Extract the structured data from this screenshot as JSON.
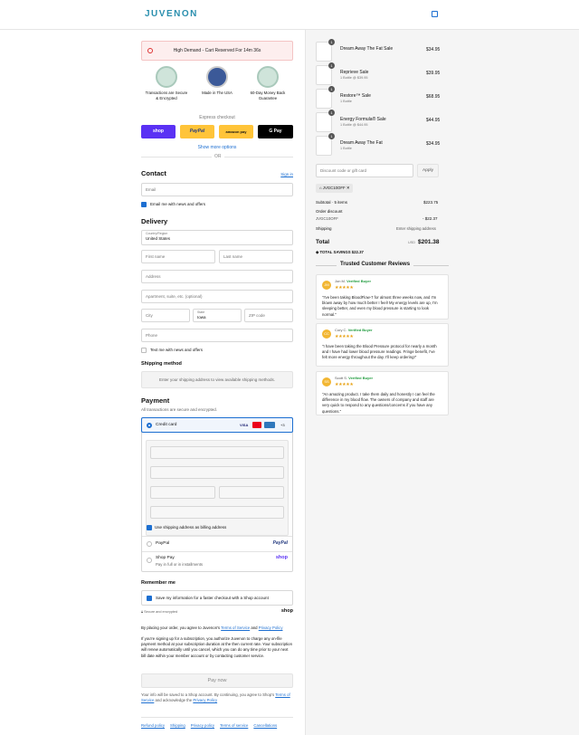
{
  "header": {
    "logo": "JUVENON"
  },
  "demand": "High Demand - Cart Reserved For 14m 36s",
  "badges": [
    {
      "label": "Transactions are Secure & Encrypted"
    },
    {
      "label": "Made in The USA"
    },
    {
      "label": "60-Day Money Back Guarantee"
    }
  ],
  "express": {
    "title": "Express checkout",
    "shop": "shop",
    "paypal": "PayPal",
    "amazon": "amazon pay",
    "gpay": "G Pay",
    "more": "Show more options",
    "or": "OR"
  },
  "contact": {
    "title": "Contact",
    "signin": "Sign in",
    "email_ph": "Email",
    "news": "Email me with news and offers"
  },
  "delivery": {
    "title": "Delivery",
    "country_label": "Country/Region",
    "country": "United States",
    "first": "First name",
    "last": "Last name",
    "address": "Address",
    "apt": "Apartment, suite, etc. (optional)",
    "city": "City",
    "state_label": "State",
    "state": "Iowa",
    "zip": "ZIP code",
    "phone": "Phone",
    "text": "Text me with news and offers"
  },
  "shipping": {
    "title": "Shipping method",
    "note": "Enter your shipping address to view available shipping methods."
  },
  "payment": {
    "title": "Payment",
    "sub": "All transactions are secure and encrypted.",
    "card": "Credit card",
    "more_cards": "+3",
    "billing": "Use shipping address as billing address",
    "paypal": "PayPal",
    "shoppay": "Shop Pay",
    "shoppay_sub": "Pay in full or in installments",
    "paypal_logo": "PayPal",
    "shop_logo": "shop"
  },
  "remember": {
    "title": "Remember me",
    "save": "Save my information for a faster checkout with a Shop account",
    "secure": "Secure and encrypted",
    "shop": "shop"
  },
  "legal": {
    "p1a": "By placing your order, you agree to Juvenon's ",
    "tos": "Terms of Service",
    "and": " and ",
    "privacy": "Privacy Policy",
    "p2": "If you're signing up for a subscription, you authorize Juvenon to charge any on-file payment method at your subscription duration at the then current rate. Your subscription will renew automatically until you cancel, which you can do any time prior to your next bill date within your member account or by contacting customer service.",
    "pay": "Pay now",
    "p3a": "Your info will be saved to a Shop account. By continuing, you agree to Shop's ",
    "p3tos": "Terms of Service",
    "p3b": " and acknowledge the ",
    "p3pp": "Privacy Policy"
  },
  "footer": [
    "Refund policy",
    "Shipping",
    "Privacy policy",
    "Terms of service",
    "Cancellations"
  ],
  "cart": {
    "items": [
      {
        "name": "Dream Away The Fat Sale",
        "sub": "",
        "price": "$34.95",
        "qty": "1"
      },
      {
        "name": "Reprieve Sale",
        "sub": "1 Bottle @ $39.95",
        "price": "$39.95",
        "qty": "1"
      },
      {
        "name": "Restore™ Sale",
        "sub": "1 Bottle",
        "price": "$68.95",
        "qty": "1"
      },
      {
        "name": "Energy Formula® Sale",
        "sub": "1 Bottle @ $44.95",
        "price": "$44.95",
        "qty": "1"
      },
      {
        "name": "Dream Away The Fat",
        "sub": "1 Bottle",
        "price": "$34.95",
        "qty": "1"
      }
    ],
    "discount_ph": "Discount code or gift card",
    "apply": "Apply",
    "code": "JVGC10OFF",
    "subtotal_label": "Subtotal · 5 items",
    "subtotal": "$223.75",
    "order_discount": "Order discount",
    "disc_code": "JVGC10OFF",
    "disc_val": "- $22.37",
    "shipping_label": "Shipping",
    "shipping_val": "Enter shipping address",
    "total_label": "Total",
    "currency": "USD",
    "total": "$201.38",
    "savings": "TOTAL SAVINGS $22.37"
  },
  "reviews": {
    "title": "Trusted Customer Reviews",
    "items": [
      {
        "init": "JM",
        "name": "Jon M.",
        "verified": "Verified Buyer",
        "text": "\"I've been taking BloodFlow-7 for almost three weeks now, and I'm blown away by how much better I feel! My energy levels are up, I'm sleeping better, and even my blood pressure is starting to look normal.\""
      },
      {
        "init": "CC",
        "name": "Cory C.",
        "verified": "Verified Buyer",
        "text": "\"I have been taking the Blood Pressure protocol for nearly a month and I have had lower blood pressure readings. Fringe benefit, I've felt more energy throughout the day. I'll keep ordering!\""
      },
      {
        "init": "SS",
        "name": "Scott S.",
        "verified": "Verified Buyer",
        "text": "\"An amazing product. I take them daily and honestly I can feel the difference in my blood flow. The owners of company and staff are very quick to respond to any questions/concerns if you have any questions.\""
      }
    ]
  },
  "colors": {
    "brand": "#2a8fae",
    "accent": "#1d6fd1",
    "shop": "#5a31f4",
    "paypal": "#ffc439"
  }
}
